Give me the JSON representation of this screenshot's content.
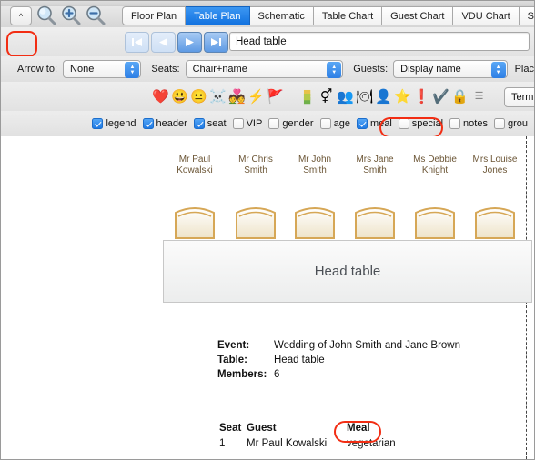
{
  "window": {
    "title": "Table Plan"
  },
  "tabs": [
    {
      "label": "Floor Plan",
      "active": false
    },
    {
      "label": "Table Plan",
      "active": true
    },
    {
      "label": "Schematic",
      "active": false
    },
    {
      "label": "Table Chart",
      "active": false
    },
    {
      "label": "Guest Chart",
      "active": false
    },
    {
      "label": "VDU Chart",
      "active": false
    },
    {
      "label": "Stationery",
      "active": false
    }
  ],
  "toolbar": {
    "collapse_label": "^",
    "zoom_icon": "magnifier-icon",
    "zoom_in_icon": "magnifier-plus-icon",
    "zoom_out_icon": "magnifier-minus-icon",
    "nav_first_icon": "first-table-icon",
    "nav_prev_icon": "previous-table-icon",
    "nav_next_icon": "next-table-icon",
    "nav_last_icon": "last-table-icon",
    "table_field_value": "Head table"
  },
  "options": {
    "arrow_to_label": "Arrow to:",
    "arrow_to_value": "None",
    "seats_label": "Seats:",
    "seats_value": "Chair+name",
    "guests_label": "Guests:",
    "guests_value": "Display name",
    "place_label": "Plac"
  },
  "icon_toolbar": {
    "icons": [
      {
        "name": "heart-icon",
        "glyph": "❤️"
      },
      {
        "name": "smiley-yellow-icon",
        "glyph": "😃"
      },
      {
        "name": "smiley-purple-icon",
        "glyph": "😐"
      },
      {
        "name": "skull-icon",
        "glyph": "☠️"
      },
      {
        "name": "couple-icon",
        "glyph": "💑"
      },
      {
        "name": "lightning-icon",
        "glyph": "⚡"
      },
      {
        "name": "flag-icon",
        "glyph": "🚩"
      },
      {
        "name": "gradient-icon",
        "glyph": "■"
      },
      {
        "name": "gender-icon",
        "glyph": "⚥"
      },
      {
        "name": "group-icon",
        "glyph": "👥"
      },
      {
        "name": "meal-icon",
        "glyph": "🍽"
      },
      {
        "name": "vip-icon",
        "glyph": "👤"
      },
      {
        "name": "star-icon",
        "glyph": "⭐"
      },
      {
        "name": "exclamation-icon",
        "glyph": "❗"
      },
      {
        "name": "checkmark-icon",
        "glyph": "✔️"
      },
      {
        "name": "lock-icon",
        "glyph": "🔒"
      },
      {
        "name": "list-icon",
        "glyph": "☰"
      }
    ],
    "term_button_label": "Term"
  },
  "checkboxes": [
    {
      "label": "legend",
      "checked": true,
      "highlighted": false
    },
    {
      "label": "header",
      "checked": true,
      "highlighted": false
    },
    {
      "label": "seat",
      "checked": true,
      "highlighted": false
    },
    {
      "label": "VIP",
      "checked": false,
      "highlighted": false
    },
    {
      "label": "gender",
      "checked": false,
      "highlighted": false
    },
    {
      "label": "age",
      "checked": false,
      "highlighted": false
    },
    {
      "label": "meal",
      "checked": true,
      "highlighted": true
    },
    {
      "label": "special",
      "checked": false,
      "highlighted": false
    },
    {
      "label": "notes",
      "checked": false,
      "highlighted": false
    },
    {
      "label": "grou",
      "checked": false,
      "highlighted": false
    }
  ],
  "plan": {
    "table_label": "Head table",
    "seat_names": [
      "Mr Paul\nKowalski",
      "Mr Chris\nSmith",
      "Mr John\nSmith",
      "Mrs Jane\nSmith",
      "Ms Debbie\nKnight",
      "Mrs Louise\nJones"
    ]
  },
  "details": {
    "event_key": "Event:",
    "event_value": "Wedding of John Smith and Jane Brown",
    "table_key": "Table:",
    "table_value": "Head table",
    "members_key": "Members:",
    "members_value": "6"
  },
  "seat_table": {
    "headers": {
      "seat": "Seat",
      "guest": "Guest",
      "meal": "Meal"
    },
    "meal_highlighted": true,
    "rows": [
      {
        "seat": "1",
        "guest": "Mr Paul Kowalski",
        "meal": "vegetarian"
      }
    ]
  },
  "colors": {
    "accent": "#1272e0",
    "highlight_ring": "#f22d13",
    "chair_outline": "#d6a756",
    "seat_name_text": "#6b5535"
  }
}
